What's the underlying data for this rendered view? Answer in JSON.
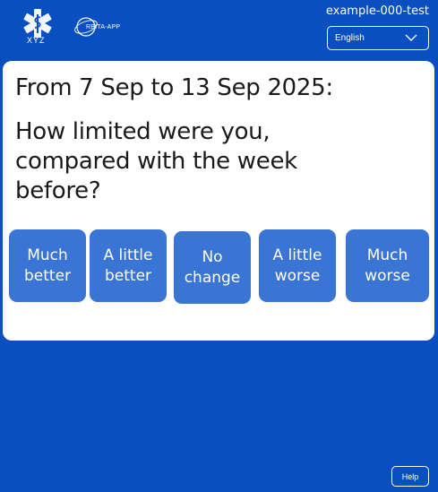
{
  "header": {
    "logo_caption": "XYZ",
    "partner_logo_text": "RBITA-APP",
    "username": "example-000-test",
    "language": {
      "selected": "English",
      "icon": "chevron-down-icon"
    }
  },
  "survey": {
    "date_range": "From 7 Sep to 13 Sep 2025:",
    "question": "How limited were you, compared with the week before?",
    "options": [
      {
        "label": "Much better"
      },
      {
        "label": "A little better"
      },
      {
        "label": "No change"
      },
      {
        "label": "A little worse"
      },
      {
        "label": "Much worse"
      }
    ]
  },
  "footer": {
    "help_label": "Help"
  },
  "colors": {
    "background": "#0a4fc0",
    "card": "#ffffff",
    "option_button": "#3a74d4",
    "text_dark": "#1a1a1a",
    "text_light": "#ffffff"
  }
}
